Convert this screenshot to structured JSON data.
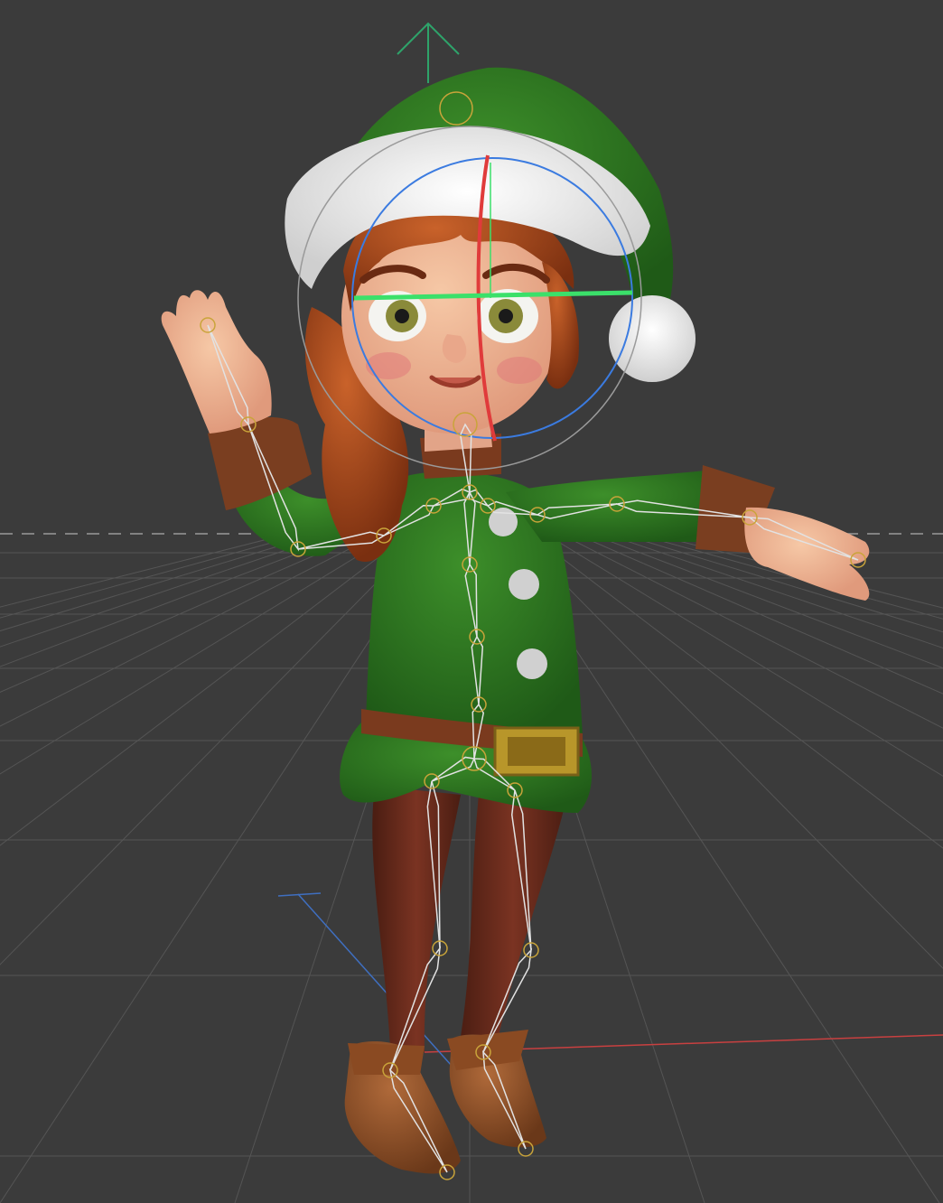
{
  "app": {
    "view": "3D viewport",
    "colors": {
      "background": "#3b3b3b",
      "grid": "#4e4e4e",
      "horizon": "#8a8a8a",
      "axis_x": "#c03a3a",
      "axis_z": "#3f6fc0",
      "gizmo_up": "#2ea36a",
      "bone": "#e2e2e2",
      "joint": "#c9a43a",
      "rotate_ring_blue": "#3b7be0",
      "rotate_ring_red": "#e03b3b",
      "rotate_ring_green": "#3be06a",
      "rotate_ring_outer": "#9a9a9a"
    }
  },
  "scene": {
    "object": "elf-character",
    "selected_bone": "head",
    "active_tool": "rotate"
  }
}
